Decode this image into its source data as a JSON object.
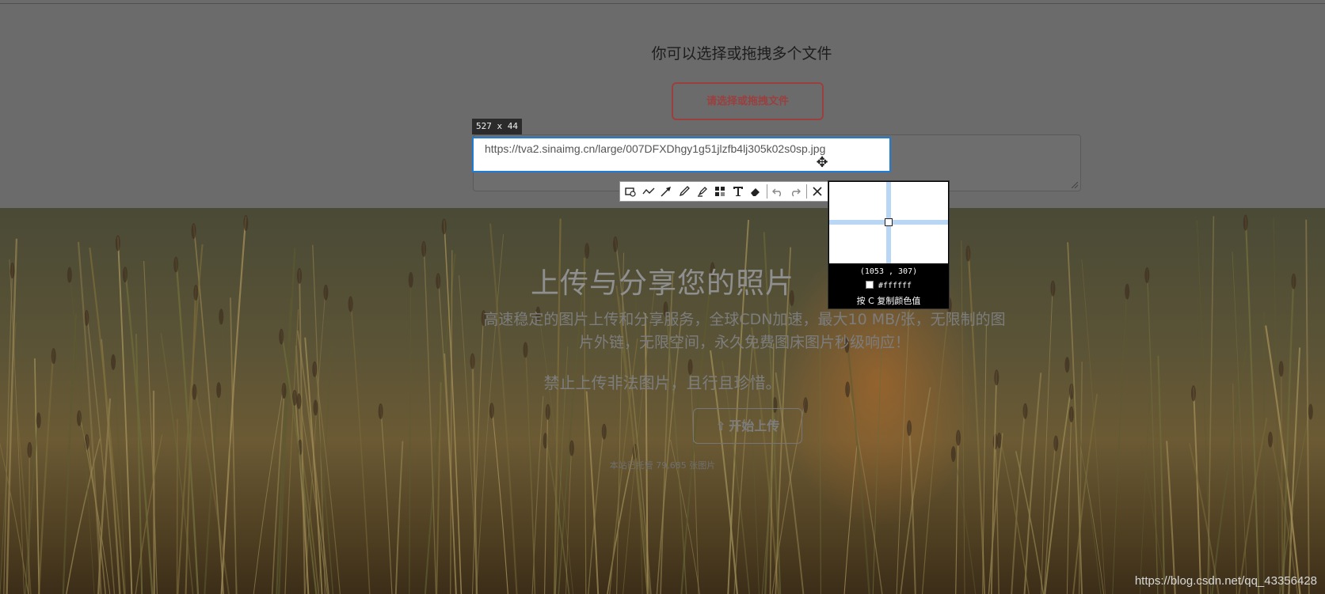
{
  "panel": {
    "title": "你可以选择或拖拽多个文件",
    "pick_button": "请选择或拖拽文件"
  },
  "screenshot_tool": {
    "selection_size": "527 x 44",
    "selected_text": "https://tva2.sinaimg.cn/large/007DFXDhgy1g51jlzfb4lj305k02s0sp.jpg",
    "toolbar": [
      "rectangle-icon",
      "polyline-icon",
      "arrow-icon",
      "pencil-icon",
      "marker-icon",
      "mosaic-icon",
      "text-icon",
      "eraser-icon",
      "undo-icon",
      "redo-icon",
      "close-icon"
    ],
    "magnifier": {
      "coordinates": "(1053 , 307)",
      "color_hex": "#ffffff",
      "hint": "按 C 复制颜色值"
    }
  },
  "hero": {
    "title": "上传与分享您的照片",
    "description": "高速稳定的图片上传和分享服务，全球CDN加速，最大10 MB/张，无限制的图片外链，无限空间，永久免费图床图片秒级响应！",
    "warning": "禁止上传非法图片，且行且珍惜。",
    "upload_button": "开始上传",
    "hosted_count": "本站已托管 79,685 张图片"
  },
  "watermark": "https://blog.csdn.net/qq_43356428",
  "colors": {
    "accent": "#9b3f3f",
    "selection": "#1e7bd6",
    "overlay": "#6b6b6b"
  }
}
